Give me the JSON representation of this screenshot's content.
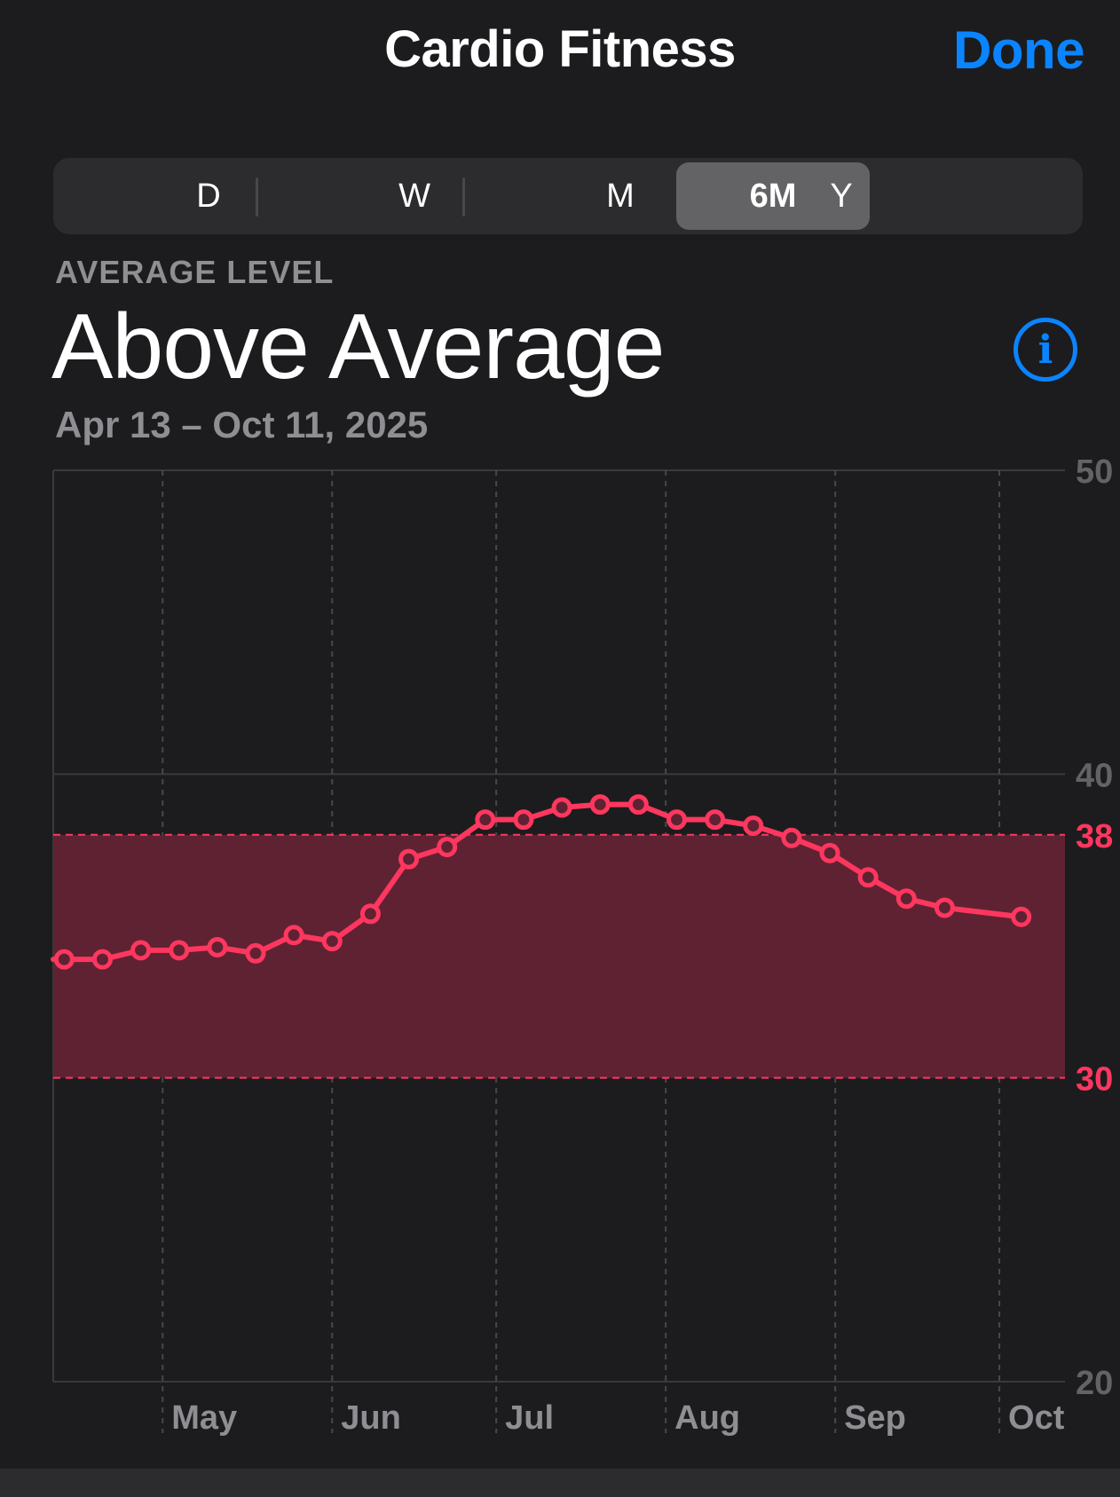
{
  "header": {
    "title": "Cardio Fitness",
    "done_label": "Done",
    "accent_color": "#0a84ff"
  },
  "range_tabs": [
    {
      "label": "D",
      "selected": false
    },
    {
      "label": "W",
      "selected": false
    },
    {
      "label": "M",
      "selected": false
    },
    {
      "label": "6M",
      "selected": true
    },
    {
      "label": "Y",
      "selected": false
    }
  ],
  "summary": {
    "label": "AVERAGE LEVEL",
    "value": "Above Average",
    "date_range": "Apr 13 – Oct 11, 2025",
    "info_icon": "info-circle-icon"
  },
  "chart_data": {
    "type": "line",
    "x_labels": [
      "May",
      "Jun",
      "Jul",
      "Aug",
      "Sep",
      "Oct"
    ],
    "y_ticks": [
      "50",
      "40",
      "20"
    ],
    "ylim": [
      20,
      50
    ],
    "band": {
      "low": 30,
      "high": 38,
      "low_label": "30",
      "high_label": "38",
      "color": "#ff375f"
    },
    "series": [
      {
        "color": "#ff375f",
        "x": [
          "2025-04-13",
          "2025-04-20",
          "2025-04-27",
          "2025-05-04",
          "2025-05-11",
          "2025-05-18",
          "2025-05-25",
          "2025-06-01",
          "2025-06-08",
          "2025-06-15",
          "2025-06-22",
          "2025-06-29",
          "2025-07-06",
          "2025-07-13",
          "2025-07-20",
          "2025-07-27",
          "2025-08-03",
          "2025-08-10",
          "2025-08-17",
          "2025-08-24",
          "2025-08-31",
          "2025-09-07",
          "2025-09-14",
          "2025-09-21",
          "2025-10-05"
        ],
        "values": [
          33.9,
          33.9,
          34.2,
          34.2,
          34.3,
          34.1,
          34.7,
          34.5,
          35.4,
          37.2,
          37.6,
          38.5,
          38.5,
          38.9,
          39.0,
          39.0,
          38.5,
          38.5,
          38.3,
          37.9,
          37.4,
          36.6,
          35.9,
          35.6,
          35.3
        ]
      }
    ]
  }
}
